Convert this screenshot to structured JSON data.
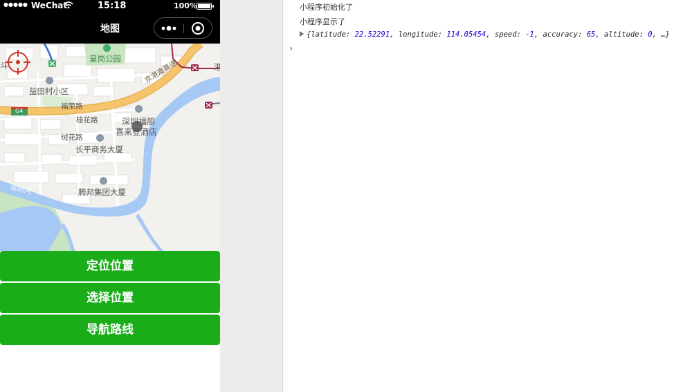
{
  "status_bar": {
    "signal": "●●●●●",
    "carrier": "WeChat",
    "time": "15:18",
    "battery": "100%"
  },
  "nav": {
    "title": "地图"
  },
  "map_labels": {
    "huanggang_park": "皇岗公园",
    "yitian_village": "益田村小区",
    "dou": "斗",
    "gang": "港",
    "jinggangao": "京港澳高速",
    "g4": "G4",
    "furong_road": "福荣路",
    "guihua_road": "桂花路",
    "shenzhen_fupeng": "深圳福朋",
    "xilaideng": "喜来登酒店",
    "ronghua_road": "绒花路",
    "changping": "长平商务大厦",
    "tengbang": "腾邦集团大厦",
    "shenzhen_river": "深圳河"
  },
  "buttons": {
    "locate": "定位位置",
    "choose": "选择位置",
    "navigate": "导航路线"
  },
  "console": {
    "line1": "小程序初始化了",
    "line2": "小程序显示了",
    "object": {
      "open": "{",
      "latitude_key": "latitude",
      "latitude_val": "22.52291",
      "longitude_key": "longitude",
      "longitude_val": "114.05454",
      "speed_key": "speed",
      "speed_val": "-1",
      "accuracy_key": "accuracy",
      "accuracy_val": "65",
      "altitude_key": "altitude",
      "altitude_val": "0",
      "ellipsis": "…}"
    },
    "prompt": "›"
  },
  "colors": {
    "green": "#1aad19",
    "river": "#a6c8f5",
    "highway": "#f5c46b",
    "console_number": "#1c00cf"
  }
}
